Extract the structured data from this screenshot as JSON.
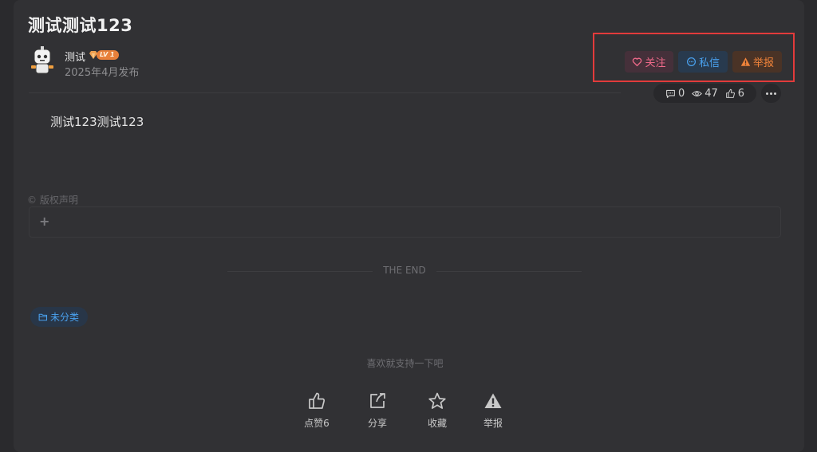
{
  "post": {
    "title": "测试测试123",
    "content": "测试123测试123"
  },
  "author": {
    "name": "测试",
    "level": "LV 1",
    "published": "2025年4月发布"
  },
  "actions": {
    "follow": "关注",
    "message": "私信",
    "report": "举报"
  },
  "stats": {
    "comments": "0",
    "views": "47",
    "likes": "6"
  },
  "copyright": {
    "label": "© 版权声明",
    "expand": "+"
  },
  "the_end": "THE END",
  "category": "未分类",
  "support_text": "喜欢就支持一下吧",
  "footer_actions": {
    "like": "点赞6",
    "share": "分享",
    "favorite": "收藏",
    "report": "举报"
  },
  "colors": {
    "highlight_border": "#e23b3b",
    "follow": "#f06a8a",
    "message": "#4aa2f0",
    "report": "#f0833a"
  }
}
